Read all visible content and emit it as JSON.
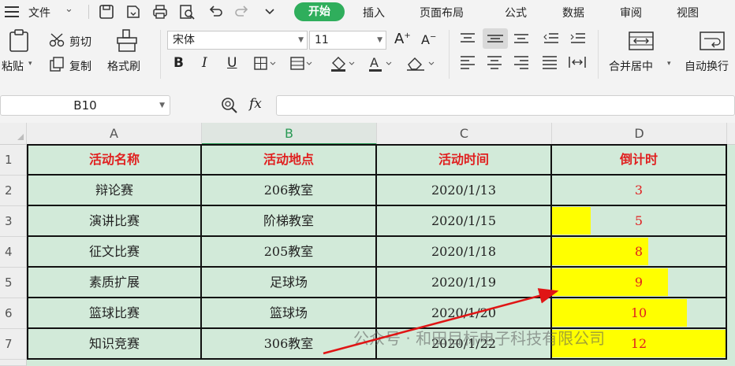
{
  "menubar": {
    "file_label": "文件",
    "tabs": [
      "开始",
      "插入",
      "页面布局",
      "公式",
      "数据",
      "审阅",
      "视图"
    ]
  },
  "ribbon": {
    "paste_label": "粘贴",
    "cut_label": "剪切",
    "copy_label": "复制",
    "format_painter_label": "格式刷",
    "font_name": "宋体",
    "font_size": "11",
    "bold_label": "B",
    "italic_label": "I",
    "underline_label": "U",
    "merge_center_label": "合并居中",
    "wrap_label": "自动换行"
  },
  "formula_bar": {
    "name_box": "B10",
    "fx_label": "fx",
    "formula": ""
  },
  "sheet": {
    "columns": [
      "A",
      "B",
      "C",
      "D"
    ],
    "row_numbers": [
      "1",
      "2",
      "3",
      "4",
      "5",
      "6",
      "7"
    ],
    "header": [
      "活动名称",
      "活动地点",
      "活动时间",
      "倒计时"
    ],
    "rows": [
      [
        "辩论赛",
        "206教室",
        "2020/1/13",
        "3"
      ],
      [
        "演讲比赛",
        "阶梯教室",
        "2020/1/15",
        "5"
      ],
      [
        "征文比赛",
        "205教室",
        "2020/1/18",
        "8"
      ],
      [
        "素质扩展",
        "足球场",
        "2020/1/19",
        "9"
      ],
      [
        "篮球比赛",
        "篮球场",
        "2020/1/20",
        "10"
      ],
      [
        "知识竞赛",
        "306教室",
        "2020/1/22",
        "12"
      ]
    ],
    "databar_color": "#ffff00",
    "header_text_color": "#e02020",
    "cell_fill_color": "#d2ead9"
  },
  "watermark": "公众号 · 和田目标电子科技有限公司"
}
